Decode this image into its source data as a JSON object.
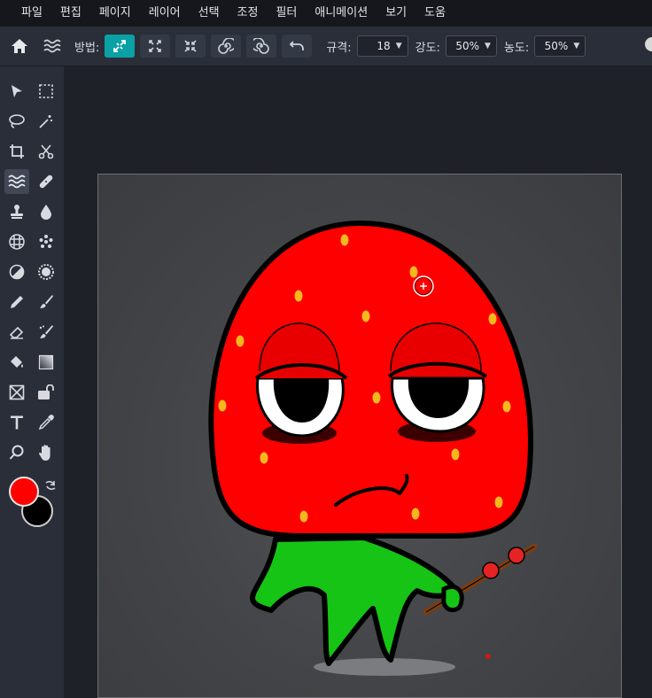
{
  "menu": [
    "파일",
    "편집",
    "페이지",
    "레이어",
    "선택",
    "조정",
    "필터",
    "애니메이션",
    "보기",
    "도움"
  ],
  "toolbar": {
    "home_icon": "home-icon",
    "tool_icon": "liquify-icon",
    "method_label": "방법:",
    "modes": [
      "push-icon",
      "expand-icon",
      "shrink-icon",
      "swirl-right-icon",
      "swirl-left-icon",
      "undo-icon"
    ],
    "size_label": "규격:",
    "size_value": "18",
    "strength_label": "강도:",
    "strength_value": "50%",
    "density_label": "농도:",
    "density_value": "50%"
  },
  "colors": {
    "accent": "#0aa1a6",
    "foreground": "#ff0000",
    "background": "#000000"
  },
  "tools": [
    "move-icon",
    "marquee-icon",
    "lasso-icon",
    "magic-wand-icon",
    "crop-icon",
    "scissors-icon",
    "liquify-icon",
    "healing-icon",
    "stamp-icon",
    "blur-drop-icon",
    "pixelate-icon",
    "dots-icon",
    "dodge-icon",
    "sponge-icon",
    "pencil-icon",
    "brush-icon",
    "eraser-icon",
    "smudge-brush-icon",
    "bucket-icon",
    "gradient-icon",
    "shape-icon",
    "lock-shape-icon",
    "text-icon",
    "eyedropper-icon",
    "zoom-icon",
    "hand-icon"
  ]
}
